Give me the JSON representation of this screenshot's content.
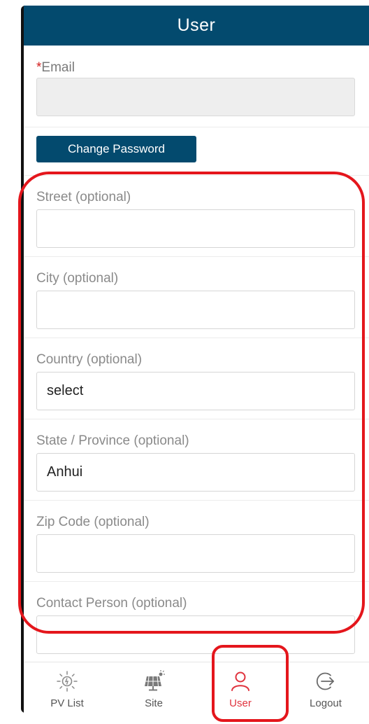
{
  "header": {
    "title": "User"
  },
  "email": {
    "required_mark": "*",
    "label": "Email",
    "value": ""
  },
  "change_password": {
    "label": "Change Password"
  },
  "fields": [
    {
      "label": "Street (optional)",
      "value": ""
    },
    {
      "label": "City (optional)",
      "value": ""
    },
    {
      "label": "Country (optional)",
      "value": "select"
    },
    {
      "label": "State / Province (optional)",
      "value": "Anhui"
    },
    {
      "label": "Zip Code (optional)",
      "value": ""
    },
    {
      "label": "Contact Person (optional)",
      "value": ""
    }
  ],
  "tabs": [
    {
      "label": "PV List",
      "icon": "sun-icon"
    },
    {
      "label": "Site",
      "icon": "solar-panel-icon"
    },
    {
      "label": "User",
      "icon": "user-icon",
      "active": true
    },
    {
      "label": "Logout",
      "icon": "logout-icon"
    }
  ],
  "colors": {
    "header": "#034a6e",
    "accent_red": "#e0323d",
    "annotation_red": "#e4161c"
  }
}
